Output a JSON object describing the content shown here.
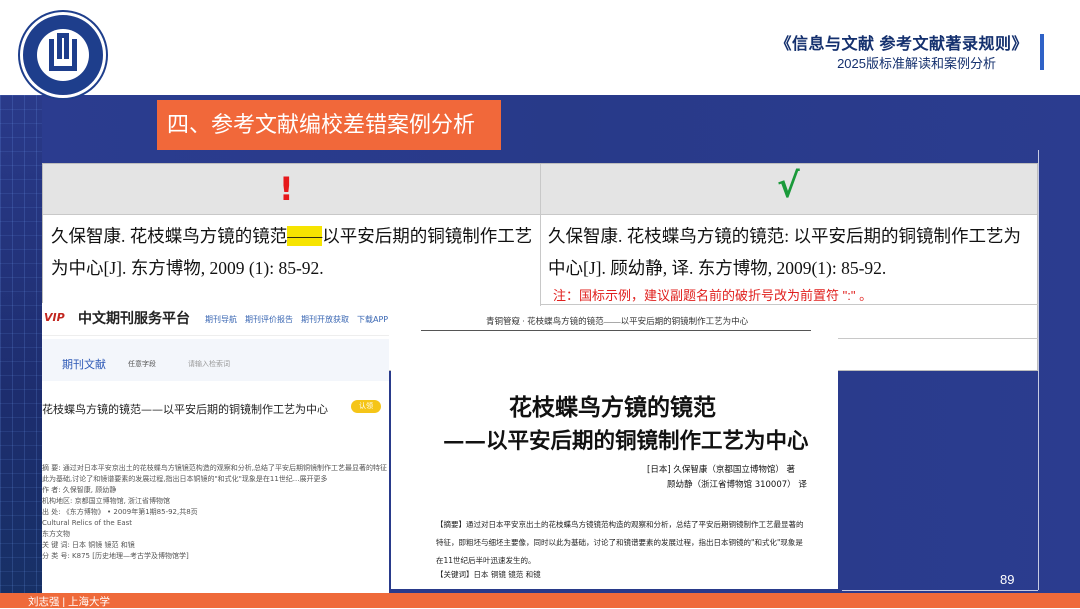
{
  "header": {
    "logo_ring_text": "PUBLISHING AGENCY OF SHANGHAI UNIVERSITY",
    "title": "《信息与文献 参考文献著录规则》",
    "subtitle": "2025版标准解读和案例分析"
  },
  "section_title": "四、参考文献编校差错案例分析",
  "table": {
    "wrong_mark": "!",
    "right_mark": "√",
    "wrong_text_pre": "久保智康. 花枝蝶鸟方镜的镜范",
    "wrong_text_dash": "——",
    "wrong_text_post": "以平安后期的铜镜制作工艺为中心[J]. 东方博物, 2009 (1): 85-92.",
    "right_text": "久保智康. 花枝蝶鸟方镜的镜范: 以平安后期的铜镜制作工艺为中心[J]. 顾幼静, 译. 东方博物, 2009(1): 85-92.",
    "note": "注：国标示例，建议副题名前的破折号改为前置符 \":\" 。"
  },
  "screenshot1": {
    "logo": "VIP",
    "platform": "中文期刊服务平台",
    "nav": [
      "期刊导航",
      "期刊评价报告",
      "期刊开放获取",
      "下载APP"
    ],
    "tab": "期刊文献",
    "select": "任意字段",
    "search_placeholder": "请输入检索词",
    "article_title": "花枝蝶鸟方镜的镜范——以平安后期的铜镜制作工艺为中心",
    "badge": "认领",
    "meta": [
      "摘  要: 通过对日本平安京出土的花枝蝶鸟方镜镜范构造的观察和分析,总结了平安后期铜镜制作工艺最显著的特征",
      "此为基础,讨论了和镜谱要素的发展过程,指出日本铜镜的\"和式化\"现象是在11世纪...展开更多",
      "作  者: 久保智康, 顾幼静",
      "机构地区: 京都国立博物馆, 浙江省博物馆",
      "出  处: 《东方博物》 • 2009年第1期85-92,共8页",
      "Cultural Relics of the East",
      "东方文物",
      "关 键 词: 日本 铜镜 镜范 和镜",
      "分 类 号: K875 [历史地理—考古学及博物馆学]"
    ]
  },
  "screenshot2": {
    "running_head": "青铜管窥 · 花枝蝶鸟方镜的镜范——以平安后期的铜镜制作工艺为中心",
    "title_line1": "花枝蝶鸟方镜的镜范",
    "title_line2": "——以平安后期的铜镜制作工艺为中心",
    "author1": "[日本] 久保智康（京都国立博物馆） 著",
    "author2": "顾幼静（浙江省博物馆 310007） 译",
    "abstract": "【摘要】通过对日本平安京出土的花枝蝶鸟方镜镜范构造的观察和分析，总结了平安后期铜镜制作工艺最显著的特征，即粗坯与细坯主要像，同时以此为基础，讨论了和镜谱要素的发展过程，指出日本铜镜的\"和式化\"现象是在11世纪后半叶迅速发生的。",
    "keywords": "【关键词】日本  铜镜  镜范  和镜"
  },
  "page_number": "89",
  "footer": "刘志强 | 上海大学"
}
